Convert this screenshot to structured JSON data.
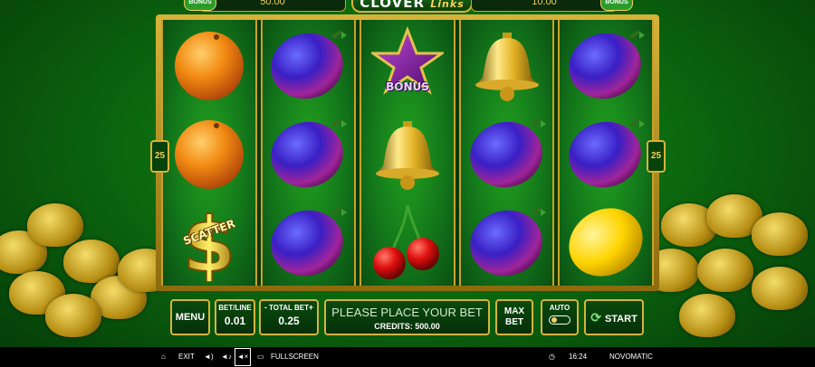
{
  "header": {
    "left_badge": "BONUS",
    "left_value": "50.00",
    "logo_main": "CLOVER",
    "logo_sub": "Links",
    "right_value": "10.00",
    "right_badge": "BONUS"
  },
  "reels": {
    "line_count_left": "25",
    "line_count_right": "25",
    "columns": [
      [
        "orange",
        "orange",
        "scatter"
      ],
      [
        "plum",
        "plum",
        "plum"
      ],
      [
        "bonus-star",
        "bell",
        "cherry"
      ],
      [
        "bell",
        "plum",
        "plum"
      ],
      [
        "plum",
        "plum",
        "lemon"
      ]
    ],
    "scatter_label": "SCATTER",
    "bonus_label": "BONUS"
  },
  "controls": {
    "menu_label": "MENU",
    "bet_line_label": "BET/LINE",
    "bet_line_value": "0.01",
    "total_bet_label": "TOTAL BET",
    "total_bet_value": "0.25",
    "minus_label": "-",
    "plus_label": "+",
    "message": "PLEASE PLACE YOUR BET",
    "credits": "CREDITS: 500.00",
    "max_bet_line1": "MAX",
    "max_bet_line2": "BET",
    "auto_label": "AUTO",
    "start_label": "START"
  },
  "system_bar": {
    "exit_label": "EXIT",
    "fullscreen_label": "FULLSCREEN",
    "time": "16:24",
    "brand": "NOVOMATIC"
  },
  "colors": {
    "gold": "#d7b33b",
    "green_bg": "#0c6a0f"
  }
}
